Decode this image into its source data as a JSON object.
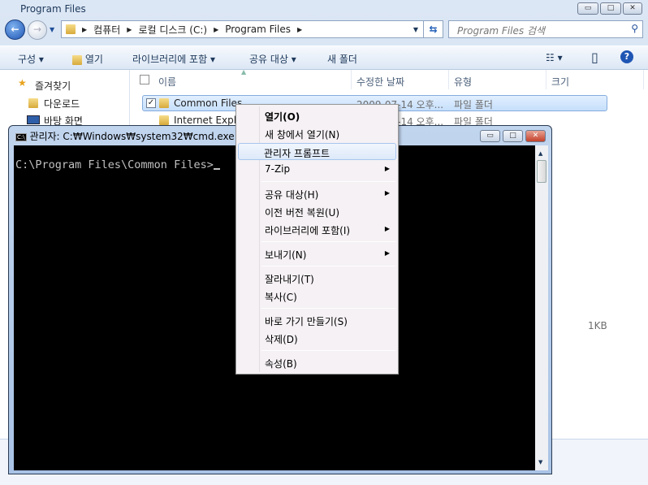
{
  "explorer": {
    "title": "Program Files",
    "window_buttons": {
      "minimize": "▭",
      "maximize": "□",
      "close": "✕"
    },
    "breadcrumb": [
      "컴퓨터",
      "로컬 디스크 (C:)",
      "Program Files"
    ],
    "search_placeholder": "Program Files 검색",
    "toolbar": {
      "organize": "구성 ▾",
      "open": "열기",
      "include_library": "라이브러리에 포함 ▾",
      "share": "공유 대상 ▾",
      "new_folder": "새 폴더",
      "views": "☷ ▾",
      "preview": "▯",
      "help": "?"
    },
    "sidebar": {
      "favorites": "즐겨찾기",
      "items": [
        "다운로드",
        "바탕 화면"
      ]
    },
    "columns": {
      "name": "이름",
      "modified": "수정한 날짜",
      "type": "유형",
      "size": "크기"
    },
    "rows": [
      {
        "name": "Common Files",
        "modified": "2009-07-14 오후...",
        "type": "파일 폴더",
        "selected": true
      },
      {
        "name": "Internet Explorer",
        "modified": "2009-07-14 오후...",
        "type": "파일 폴더",
        "selected": false
      }
    ],
    "size_value": "1KB"
  },
  "cmd": {
    "title": "관리자: C:₩Windows₩system32₩cmd.exe",
    "icon_label": "C:\\",
    "prompt": "C:\\Program Files\\Common Files>"
  },
  "context_menu": {
    "items": [
      {
        "label": "열기(O)",
        "bold": true
      },
      {
        "label": "새 창에서 열기(N)"
      },
      {
        "label": "관리자 프롬프트",
        "highlighted": true
      },
      {
        "label": "7-Zip",
        "submenu": true
      },
      {
        "label": "공유 대상(H)",
        "submenu": true
      },
      {
        "label": "이전 버전 복원(U)"
      },
      {
        "label": "라이브러리에 포함(I)",
        "submenu": true
      },
      {
        "label": "보내기(N)",
        "submenu": true
      },
      {
        "label": "잘라내기(T)"
      },
      {
        "label": "복사(C)"
      },
      {
        "label": "바로 가기 만들기(S)"
      },
      {
        "label": "삭제(D)"
      },
      {
        "label": "속성(B)"
      }
    ]
  }
}
